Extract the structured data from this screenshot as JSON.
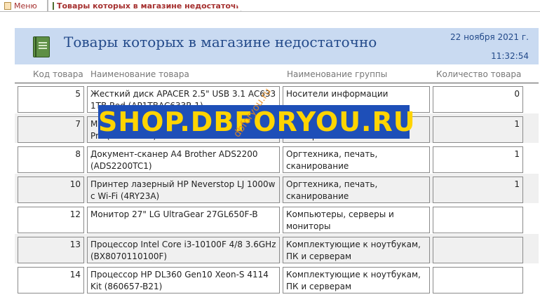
{
  "tabs": {
    "menu_label": "Меню",
    "active_label": "Товары которых в магазине недостаточно"
  },
  "report": {
    "title": "Товары которых в магазине недостаточно",
    "date": "22 ноября 2021 г.",
    "time": "11:32:54"
  },
  "columns": {
    "code": "Код товара",
    "name": "Наименование товара",
    "group": "Наименование группы",
    "qty": "Количество товара"
  },
  "rows": [
    {
      "code": "5",
      "name": "Жесткий диск APACER 2.5\" USB 3.1 AC633 1TB Red (AP1TBAC633R-1)",
      "group": "Носители информации",
      "qty": "0"
    },
    {
      "code": "7",
      "name": "МФУ лазерный Canon i-SENSYS MF3010 E3 Pro (1014C005)",
      "group": "Оргтехника, печать, сканирование",
      "qty": "1"
    },
    {
      "code": "8",
      "name": "Документ-сканер A4 Brother ADS2200 (ADS2200TC1)",
      "group": "Оргтехника, печать, сканирование",
      "qty": "1"
    },
    {
      "code": "10",
      "name": "Принтер лазерный HP Neverstop LJ 1000w c Wi-Fi (4RY23A)",
      "group": "Оргтехника, печать, сканирование",
      "qty": "1"
    },
    {
      "code": "12",
      "name": "Монитор 27\" LG UltraGear 27GL650F-B",
      "group": "Компьютеры, серверы и мониторы",
      "qty": ""
    },
    {
      "code": "13",
      "name": "Процессор Intel Core i3-10100F 4/8 3.6GHz (BX8070110100F)",
      "group": "Комплектующие к ноутбукам, ПК и серверам",
      "qty": ""
    },
    {
      "code": "14",
      "name": "Процессор HP DL360 Gen10 Xeon-S 4114 Kit (860657-B21)",
      "group": "Комплектующие к ноутбукам, ПК и серверам",
      "qty": ""
    }
  ],
  "watermark": {
    "main": "SHOP.DBFORYOU.RU",
    "diagonal": "dbforyou.ru"
  },
  "colors": {
    "header_band": "#c9daf1",
    "title_text": "#234a8a",
    "tab_text": "#a5302f",
    "watermark_bg": "#1e4fb8",
    "watermark_text": "#ffd400"
  }
}
